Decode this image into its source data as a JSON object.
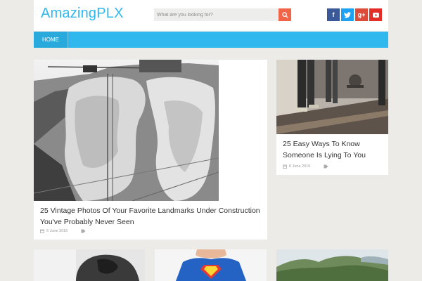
{
  "site": {
    "logo": "AmazingPLX"
  },
  "search": {
    "placeholder": "What are you looking for?"
  },
  "socials": [
    {
      "icon": "facebook-icon",
      "glyph": "f",
      "color": "#3b5998"
    },
    {
      "icon": "twitter-icon",
      "glyph": "t",
      "color": "#1da1f2"
    },
    {
      "icon": "google-plus-icon",
      "glyph": "g+",
      "color": "#dd4b39"
    },
    {
      "icon": "youtube-icon",
      "glyph": "▶",
      "color": "#e52d27"
    }
  ],
  "nav": {
    "home": "HOME"
  },
  "posts": [
    {
      "title": "25 Vintage Photos Of Your Favorite Landmarks Under Construction You've Probably Never Seen",
      "date": "6 June 2016"
    },
    {
      "title": "25 Easy Ways To Know Someone Is Lying To You",
      "date": "6 June 2016"
    }
  ],
  "colors": {
    "accent": "#2eb8ee",
    "search_button": "#f06548",
    "background": "#ecebe8"
  }
}
